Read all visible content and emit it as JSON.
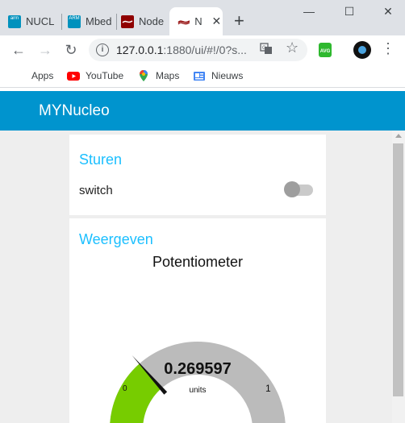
{
  "browser": {
    "tabs": [
      {
        "title": "NUCL",
        "favicon_text": "arm",
        "favicon_color": "#0091bd"
      },
      {
        "title": "Mbed",
        "favicon_text": "ARM",
        "favicon_color": "#0091bd"
      },
      {
        "title": "Node",
        "favicon_text": "",
        "favicon_color": "#8f0000"
      },
      {
        "title": "N",
        "favicon_text": "",
        "favicon_color": "#8f0000",
        "active": true
      }
    ],
    "new_tab_label": "+",
    "window_controls": {
      "minimize": "—",
      "maximize": "☐",
      "close": "✕"
    },
    "url_host": "127.0.0.1",
    "url_rest": ":1880/ui/#!/0?s...",
    "bookmarks": [
      {
        "label": "Apps",
        "icon": "apps-grid-icon"
      },
      {
        "label": "YouTube",
        "icon": "youtube-icon"
      },
      {
        "label": "Maps",
        "icon": "maps-pin-icon"
      },
      {
        "label": "Nieuws",
        "icon": "news-icon"
      }
    ],
    "extension_label": "AVG"
  },
  "dashboard": {
    "title": "MYNucleo",
    "header_color": "#0094ce",
    "accent_color": "#1bbfff",
    "groups": {
      "sturen": {
        "title": "Sturen",
        "switch_label": "switch",
        "switch_on": false
      },
      "weergeven": {
        "title": "Weergeven",
        "gauge": {
          "title": "Potentiometer",
          "value": 0.269597,
          "value_text": "0.269597",
          "units": "units",
          "min": 0,
          "max": 1,
          "min_text": "0",
          "max_text": "1",
          "fill_color": "#77cc00",
          "track_color": "#bbbbbb"
        }
      }
    }
  }
}
